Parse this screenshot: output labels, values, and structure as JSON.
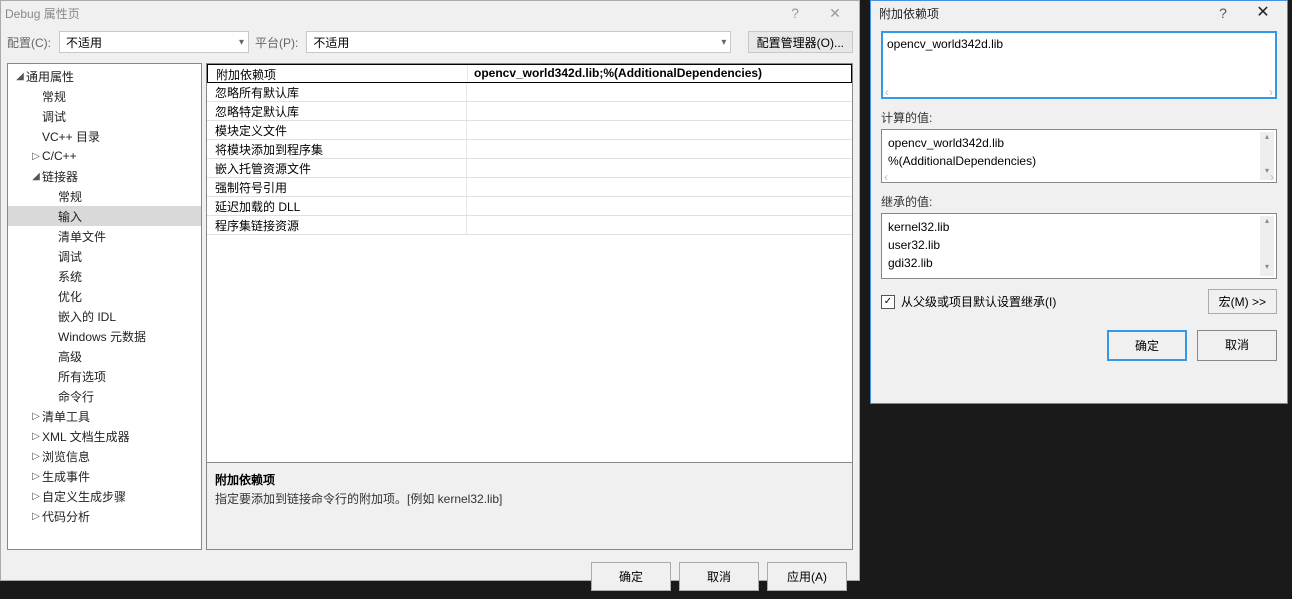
{
  "main_dialog": {
    "title": "Debug 属性页",
    "config_label": "配置(C):",
    "config_value": "不适用",
    "platform_label": "平台(P):",
    "platform_value": "不适用",
    "configmgr_label": "配置管理器(O)...",
    "tree": [
      {
        "label": "通用属性",
        "depth": 0,
        "expanded": true
      },
      {
        "label": "常规",
        "depth": 1
      },
      {
        "label": "调试",
        "depth": 1
      },
      {
        "label": "VC++ 目录",
        "depth": 1
      },
      {
        "label": "C/C++",
        "depth": 1,
        "expandable": true
      },
      {
        "label": "链接器",
        "depth": 1,
        "expanded": true
      },
      {
        "label": "常规",
        "depth": 2
      },
      {
        "label": "输入",
        "depth": 2,
        "selected": true
      },
      {
        "label": "清单文件",
        "depth": 2
      },
      {
        "label": "调试",
        "depth": 2
      },
      {
        "label": "系统",
        "depth": 2
      },
      {
        "label": "优化",
        "depth": 2
      },
      {
        "label": "嵌入的 IDL",
        "depth": 2
      },
      {
        "label": "Windows 元数据",
        "depth": 2
      },
      {
        "label": "高级",
        "depth": 2
      },
      {
        "label": "所有选项",
        "depth": 2
      },
      {
        "label": "命令行",
        "depth": 2
      },
      {
        "label": "清单工具",
        "depth": 1,
        "expandable": true
      },
      {
        "label": "XML 文档生成器",
        "depth": 1,
        "expandable": true
      },
      {
        "label": "浏览信息",
        "depth": 1,
        "expandable": true
      },
      {
        "label": "生成事件",
        "depth": 1,
        "expandable": true
      },
      {
        "label": "自定义生成步骤",
        "depth": 1,
        "expandable": true
      },
      {
        "label": "代码分析",
        "depth": 1,
        "expandable": true
      }
    ],
    "properties": [
      {
        "name": "附加依赖项",
        "value": "opencv_world342d.lib;%(AdditionalDependencies)",
        "selected": true
      },
      {
        "name": "忽略所有默认库",
        "value": ""
      },
      {
        "name": "忽略特定默认库",
        "value": ""
      },
      {
        "name": "模块定义文件",
        "value": ""
      },
      {
        "name": "将模块添加到程序集",
        "value": ""
      },
      {
        "name": "嵌入托管资源文件",
        "value": ""
      },
      {
        "name": "强制符号引用",
        "value": ""
      },
      {
        "name": "延迟加载的 DLL",
        "value": ""
      },
      {
        "name": "程序集链接资源",
        "value": ""
      }
    ],
    "desc_title": "附加依赖项",
    "desc_text": "指定要添加到链接命令行的附加项。[例如 kernel32.lib]",
    "btn_ok": "确定",
    "btn_cancel": "取消",
    "btn_apply": "应用(A)"
  },
  "sub_dialog": {
    "title": "附加依赖项",
    "editor_value": "opencv_world342d.lib",
    "computed_label": "计算的值:",
    "computed_lines": [
      "opencv_world342d.lib",
      "%(AdditionalDependencies)"
    ],
    "inherited_label": "继承的值:",
    "inherited_lines": [
      "kernel32.lib",
      "user32.lib",
      "gdi32.lib"
    ],
    "inherit_checkbox": "从父级或项目默认设置继承(I)",
    "inherit_checked": true,
    "macro_button": "宏(M) >>",
    "btn_ok": "确定",
    "btn_cancel": "取消"
  }
}
